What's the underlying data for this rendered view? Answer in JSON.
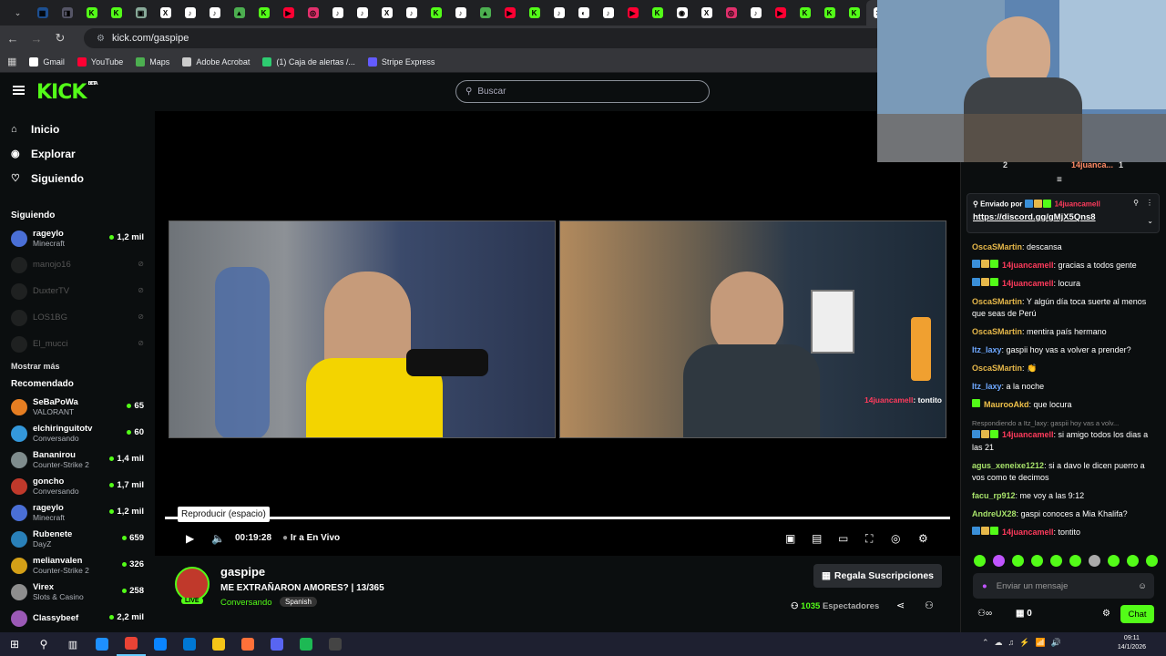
{
  "browser": {
    "url": "kick.com/gaspipe",
    "tabs": [
      {
        "color": "#1d4f91",
        "glyph": "▦"
      },
      {
        "color": "#556",
        "glyph": "◨"
      },
      {
        "color": "#53fc18",
        "glyph": "K"
      },
      {
        "color": "#53fc18",
        "glyph": "K"
      },
      {
        "color": "#8a9",
        "glyph": "▣"
      },
      {
        "color": "#fff",
        "glyph": "X"
      },
      {
        "color": "#fff",
        "glyph": "♪"
      },
      {
        "color": "#fff",
        "glyph": "♪"
      },
      {
        "color": "#4caf50",
        "glyph": "▲"
      },
      {
        "color": "#53fc18",
        "glyph": "K"
      },
      {
        "color": "#ff0033",
        "glyph": "▶"
      },
      {
        "color": "#e1306c",
        "glyph": "◎"
      },
      {
        "color": "#fff",
        "glyph": "♪"
      },
      {
        "color": "#fff",
        "glyph": "♪"
      },
      {
        "color": "#fff",
        "glyph": "X"
      },
      {
        "color": "#fff",
        "glyph": "♪"
      },
      {
        "color": "#53fc18",
        "glyph": "K"
      },
      {
        "color": "#fff",
        "glyph": "♪"
      },
      {
        "color": "#4caf50",
        "glyph": "▲"
      },
      {
        "color": "#ff0033",
        "glyph": "▶"
      },
      {
        "color": "#53fc18",
        "glyph": "K"
      },
      {
        "color": "#fff",
        "glyph": "♪"
      },
      {
        "color": "#fff",
        "glyph": "◐"
      },
      {
        "color": "#fff",
        "glyph": "♪"
      },
      {
        "color": "#ff0033",
        "glyph": "▶"
      },
      {
        "color": "#53fc18",
        "glyph": "K"
      },
      {
        "color": "#fff",
        "glyph": "◉"
      },
      {
        "color": "#fff",
        "glyph": "X"
      },
      {
        "color": "#e1306c",
        "glyph": "◎"
      },
      {
        "color": "#fff",
        "glyph": "♪"
      },
      {
        "color": "#ff0033",
        "glyph": "▶"
      },
      {
        "color": "#53fc18",
        "glyph": "K"
      },
      {
        "color": "#53fc18",
        "glyph": "K"
      },
      {
        "color": "#53fc18",
        "glyph": "K"
      },
      {
        "color": "#fff",
        "glyph": "✕"
      },
      {
        "color": "#53fc18",
        "glyph": "K"
      }
    ],
    "bookmarks": [
      {
        "label": "Gmail",
        "color": "#ffffff"
      },
      {
        "label": "YouTube",
        "color": "#ff0033"
      },
      {
        "label": "Maps",
        "color": "#4caf50"
      },
      {
        "label": "Adobe Acrobat",
        "color": "#cccccc"
      },
      {
        "label": "(1) Caja de alertas /...",
        "color": "#2ecc71"
      },
      {
        "label": "Stripe Express",
        "color": "#635bff"
      }
    ]
  },
  "header": {
    "logo": "KICK",
    "beta": "BETA",
    "search_placeholder": "Buscar"
  },
  "sidebar": {
    "nav": [
      {
        "label": "Inicio",
        "icon": "⌂"
      },
      {
        "label": "Explorar",
        "icon": "◉"
      },
      {
        "label": "Siguiendo",
        "icon": "♡"
      }
    ],
    "following_title": "Siguiendo",
    "following": [
      {
        "name": "rageylo",
        "category": "Minecraft",
        "viewers": "1,2 mil",
        "live": true,
        "color": "#4a6fd6"
      },
      {
        "name": "manojo16",
        "live": false
      },
      {
        "name": "DuxterTV",
        "live": false
      },
      {
        "name": "LOS1BG",
        "live": false
      },
      {
        "name": "El_mucci",
        "live": false
      }
    ],
    "show_more": "Mostrar más",
    "recommended_title": "Recomendado",
    "recommended": [
      {
        "name": "SeBaPoWa",
        "category": "VALORANT",
        "viewers": "65",
        "color": "#e67e22"
      },
      {
        "name": "elchiringuitotv",
        "category": "Conversando",
        "viewers": "60",
        "color": "#3498db"
      },
      {
        "name": "Bananirou",
        "category": "Counter-Strike 2",
        "viewers": "1,4 mil",
        "color": "#7f8c8d"
      },
      {
        "name": "goncho",
        "category": "Conversando",
        "viewers": "1,7 mil",
        "color": "#c0392b"
      },
      {
        "name": "rageylo",
        "category": "Minecraft",
        "viewers": "1,2 mil",
        "color": "#4a6fd6"
      },
      {
        "name": "Rubenete",
        "category": "DayZ",
        "viewers": "659",
        "color": "#2980b9"
      },
      {
        "name": "melianvalen",
        "category": "Counter-Strike 2",
        "viewers": "326",
        "color": "#d4a017"
      },
      {
        "name": "Virex",
        "category": "Slots & Casino",
        "viewers": "258",
        "color": "#8e8e8e"
      },
      {
        "name": "Classybeef",
        "category": "",
        "viewers": "2,2 mil",
        "color": "#9b59b6"
      }
    ]
  },
  "player": {
    "tooltip": "Reproducir (espacio)",
    "time": "00:19:28",
    "live_label": "Ir a En Vivo",
    "overlay_text": ": tontito",
    "progress": 1.0
  },
  "stream": {
    "streamer": "gaspipe",
    "title": "ME EXTRAÑARON AMORES? | 13/365",
    "category": "Conversando",
    "tag": "Spanish",
    "live_badge": "LIVE",
    "subs_button": "Regala Suscripciones",
    "viewers": "1035",
    "viewers_label": "Espectadores"
  },
  "chat": {
    "pinned_by": "Enviado por",
    "pinned_user": "14juancamell",
    "pinned_link": "https://discord.gg/gMjX5Qns8",
    "top_user": "14juanca...",
    "top_count": "1",
    "top_count2": "2",
    "messages": [
      {
        "user": "OscaSMartin",
        "cls": "u1",
        "text": "descansa",
        "badges": []
      },
      {
        "user": "14juancamell",
        "cls": "u2",
        "text": "gracias a todos gente",
        "badges": [
          "#3a8fd8",
          "#e6b84a",
          "#53fc18"
        ]
      },
      {
        "user": "14juancamell",
        "cls": "u2",
        "text": "locura",
        "badges": [
          "#3a8fd8",
          "#e6b84a",
          "#53fc18"
        ]
      },
      {
        "user": "OscaSMartin",
        "cls": "u1",
        "text": "Y algún día toca suerte al menos que seas de Perú",
        "badges": []
      },
      {
        "user": "OscaSMartin",
        "cls": "u1",
        "text": "mentira país hermano",
        "badges": []
      },
      {
        "user": "Itz_laxy",
        "cls": "u3",
        "text": "gaspii hoy vas a volver a prender?",
        "badges": []
      },
      {
        "user": "OscaSMartin",
        "cls": "u1",
        "text": "👏",
        "badges": []
      },
      {
        "user": "Itz_laxy",
        "cls": "u3",
        "text": "a la noche",
        "badges": []
      },
      {
        "user": "MaurooAkd",
        "cls": "u5",
        "text": "que locura",
        "badges": [
          "#53fc18"
        ]
      },
      {
        "user": "14juancamell",
        "cls": "u2",
        "text": "si amigo todos los dias a las 21",
        "badges": [
          "#3a8fd8",
          "#e6b84a",
          "#53fc18"
        ],
        "reply": "Respondiendo a Itz_laxy: gaspii hoy vas a volv..."
      },
      {
        "user": "agus_xeneixe1212",
        "cls": "u4",
        "text": "si a davo le dicen puerro a vos como te decimos",
        "badges": []
      },
      {
        "user": "facu_rp912",
        "cls": "u4",
        "text": "me voy a las 9:12",
        "badges": []
      },
      {
        "user": "AndreUX28",
        "cls": "u4",
        "text": "gaspi conoces a Mia Khalifa?",
        "badges": []
      },
      {
        "user": "14juancamell",
        "cls": "u2",
        "text": "tontito",
        "badges": [
          "#3a8fd8",
          "#e6b84a",
          "#53fc18"
        ]
      }
    ],
    "input_placeholder": "Enviar un mensaje",
    "points": "0",
    "chat_button": "Chat"
  },
  "taskbar": {
    "time": "09:11",
    "date": "14/1/2026"
  }
}
